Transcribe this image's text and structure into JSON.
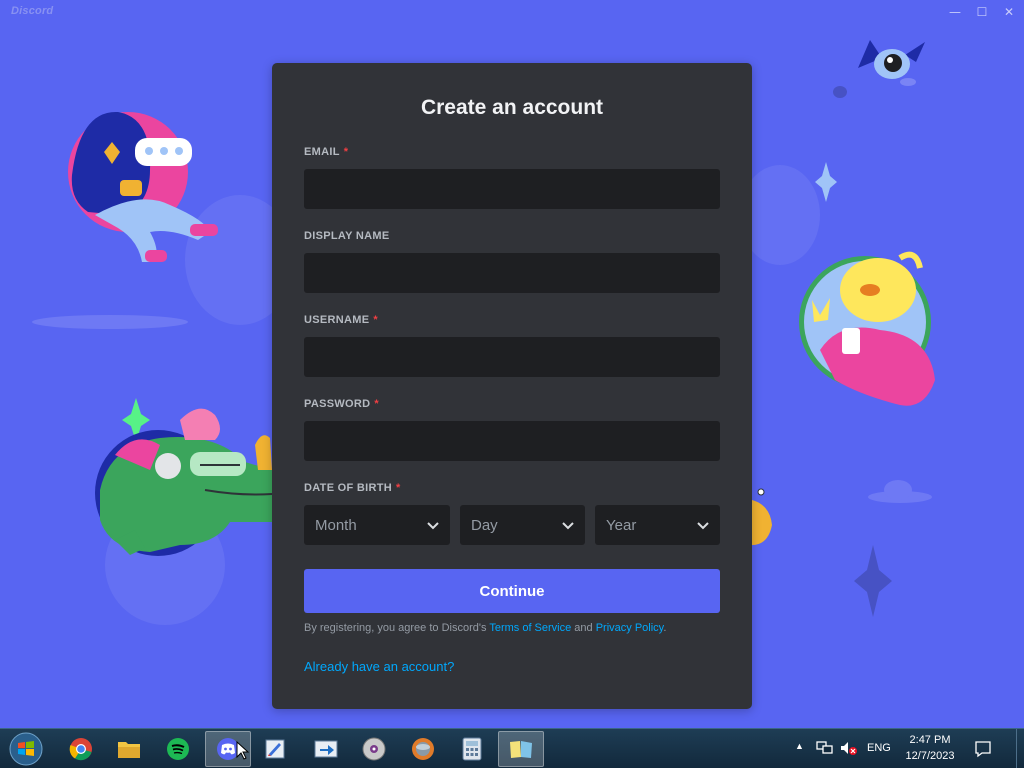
{
  "app": {
    "title": "Discord"
  },
  "window_controls": {
    "minimize": "—",
    "maximize": "☐",
    "close": "✕"
  },
  "form": {
    "title": "Create an account",
    "email_label": "EMAIL",
    "display_name_label": "DISPLAY NAME",
    "username_label": "USERNAME",
    "password_label": "PASSWORD",
    "dob_label": "DATE OF BIRTH",
    "required_mark": "*",
    "email_value": "",
    "display_name_value": "",
    "username_value": "",
    "password_value": "",
    "month_placeholder": "Month",
    "day_placeholder": "Day",
    "year_placeholder": "Year",
    "continue_label": "Continue",
    "legal_prefix": "By registering, you agree to Discord's ",
    "terms_link": "Terms of Service",
    "legal_and": " and ",
    "privacy_link": "Privacy Policy",
    "legal_suffix": ".",
    "login_link": "Already have an account?"
  },
  "taskbar": {
    "apps": [
      {
        "name": "chrome-icon",
        "active": false
      },
      {
        "name": "file-explorer-icon",
        "active": false
      },
      {
        "name": "spotify-icon",
        "active": false
      },
      {
        "name": "discord-icon",
        "active": true
      },
      {
        "name": "paint-icon",
        "active": false
      },
      {
        "name": "remote-desktop-icon",
        "active": false
      },
      {
        "name": "disc-icon",
        "active": false
      },
      {
        "name": "browser-icon",
        "active": false
      },
      {
        "name": "calculator-icon",
        "active": false
      },
      {
        "name": "notebook-icon",
        "active": false
      }
    ],
    "tray": {
      "show_hidden": "▲",
      "language": "ENG",
      "time": "2:47 PM",
      "date": "12/7/2023"
    }
  },
  "colors": {
    "background": "#5865f2",
    "modal": "#313338",
    "input": "#1e1f22",
    "accent": "#5865f2",
    "link": "#00a8fc",
    "required": "#f23f43"
  }
}
